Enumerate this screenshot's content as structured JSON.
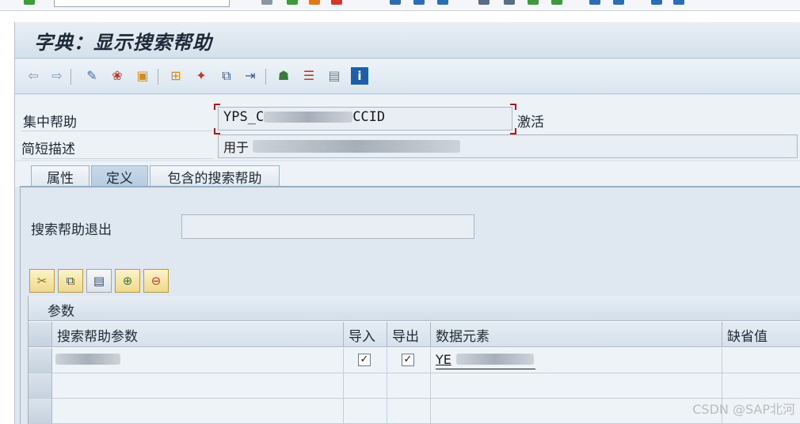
{
  "window": {
    "title": "字典：显示搜索帮助"
  },
  "toolbar": {
    "icons": [
      "back-icon",
      "forward-icon",
      "display-change-icon",
      "other-object-icon",
      "activate-icon",
      "where-used-icon",
      "object-list-icon",
      "test-icon",
      "navigate-icon",
      "hierarchy-icon",
      "layout-icon",
      "documentation-icon",
      "info-icon"
    ]
  },
  "header": {
    "search_help_label": "集中帮助",
    "search_help_value": "YPS_C",
    "search_help_value_mid": "CCID",
    "search_help_status": "激活",
    "short_desc_label": "简短描述",
    "short_desc_value": "用于"
  },
  "tabs": [
    {
      "label": "属性",
      "active": false
    },
    {
      "label": "定义",
      "active": true
    },
    {
      "label": "包含的搜索帮助",
      "active": false
    }
  ],
  "definition": {
    "exit_label": "搜索帮助退出",
    "exit_value": ""
  },
  "table_toolbar": [
    "cut-icon",
    "copy-icon",
    "paste-icon",
    "insert-row-icon",
    "delete-row-icon"
  ],
  "table": {
    "title": "参数",
    "columns": [
      "搜索帮助参数",
      "导入",
      "导出",
      "数据元素",
      "缺省值"
    ],
    "rows": [
      {
        "param": "",
        "import": true,
        "export": true,
        "data_element": "YE",
        "default": ""
      },
      {
        "param": "",
        "import": false,
        "export": false,
        "data_element": "",
        "default": ""
      },
      {
        "param": "",
        "import": false,
        "export": false,
        "data_element": "",
        "default": ""
      }
    ]
  },
  "watermark": "CSDN @SAP北河"
}
